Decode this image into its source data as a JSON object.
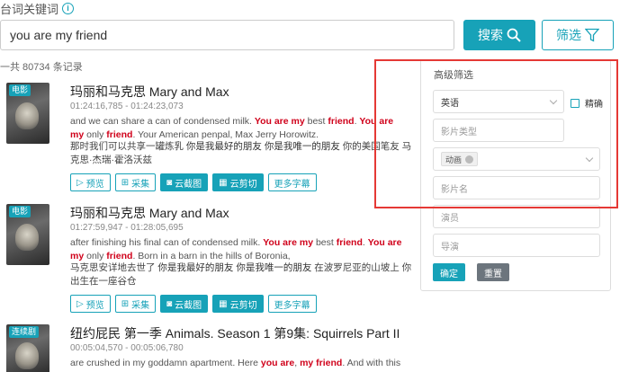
{
  "header": {
    "label": "台词关键词",
    "info_icon": "info-icon"
  },
  "search": {
    "value": "you are my friend",
    "button_label": "搜索",
    "filter_label": "筛选"
  },
  "summary": {
    "count_text": "一共 80734 条记录"
  },
  "results": [
    {
      "badge": "电影",
      "title": "玛丽和马克思 Mary and Max",
      "time": "01:24:16,785 - 01:24:23,073",
      "en": [
        {
          "t": "and we can share a can of condensed milk. "
        },
        {
          "t": "You are my",
          "hl": true
        },
        {
          "t": " best "
        },
        {
          "t": "friend",
          "hl": true
        },
        {
          "t": ". "
        },
        {
          "t": "You are my",
          "hl": true
        },
        {
          "t": " only "
        },
        {
          "t": "friend",
          "hl": true
        },
        {
          "t": ". Your American penpal, Max Jerry Horowitz."
        }
      ],
      "zh": [
        {
          "t": "那时我们可以共享一罐炼乳 "
        },
        {
          "t": "你是我最好的朋友 你是我唯一的朋友",
          "hl": true
        },
        {
          "t": " 你的美国笔友 马克思·杰瑞·霍洛沃兹"
        }
      ]
    },
    {
      "badge": "电影",
      "title": "玛丽和马克思 Mary and Max",
      "time": "01:27:59,947 - 01:28:05,695",
      "en": [
        {
          "t": "after finishing his final can of condensed milk. "
        },
        {
          "t": "You are my",
          "hl": true
        },
        {
          "t": " best "
        },
        {
          "t": "friend",
          "hl": true
        },
        {
          "t": ". "
        },
        {
          "t": "You are my",
          "hl": true
        },
        {
          "t": " only "
        },
        {
          "t": "friend",
          "hl": true
        },
        {
          "t": ". Born in a barn in the hills of Boronia,"
        }
      ],
      "zh": [
        {
          "t": "马克思安详地去世了 "
        },
        {
          "t": "你是我最好的朋友 你是我唯一的朋友",
          "hl": true
        },
        {
          "t": " 在波罗尼亚的山坡上 你出生在一座谷仓"
        }
      ]
    },
    {
      "badge": "连续剧",
      "title": "纽约屁民 第一季 Animals. Season 1 第9集: Squirrels Part II",
      "time": "00:05:04,570 - 00:05:06,780",
      "en": [
        {
          "t": "are crushed in my goddamn apartment.  Here "
        },
        {
          "t": "you are",
          "hl": true
        },
        {
          "t": ", "
        },
        {
          "t": "my friend",
          "hl": true
        },
        {
          "t": ". And with this pen,"
        }
      ],
      "zh": []
    }
  ],
  "actions": {
    "preview": "预览",
    "collect": "采集",
    "screenshot": "云截图",
    "clip": "云剪切",
    "more": "更多字幕"
  },
  "filter_panel": {
    "title": "高级筛选",
    "language": "英语",
    "exact_label": "精确",
    "type_placeholder": "影片类型",
    "genre_tag": "动画",
    "name_placeholder": "影片名",
    "actor_placeholder": "演员",
    "director_placeholder": "导演",
    "confirm_label": "确定",
    "reset_label": "重置"
  },
  "colors": {
    "accent": "#17a2b8",
    "highlight": "#d0021b",
    "annotation_box": "#e53935"
  }
}
